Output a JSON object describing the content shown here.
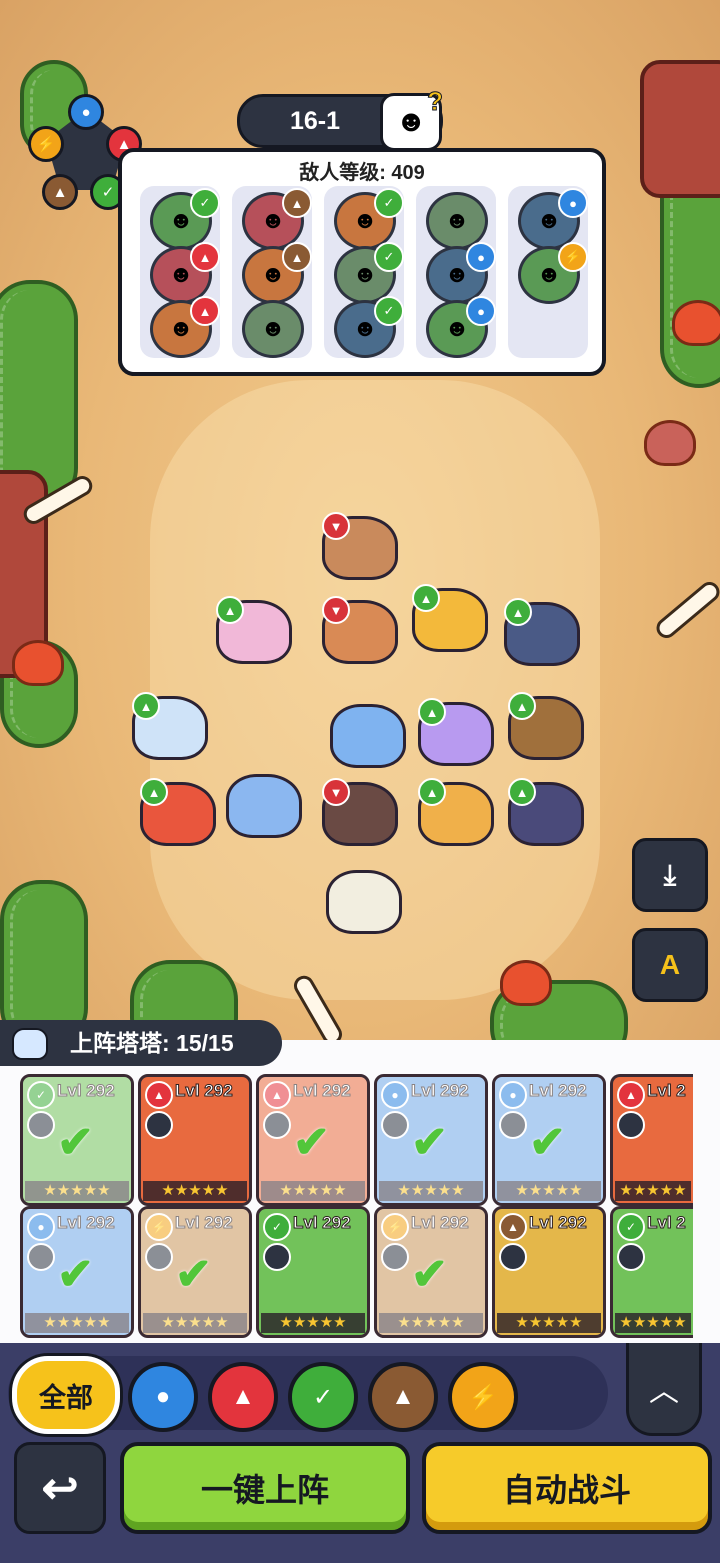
{
  "stage": {
    "label": "16-1"
  },
  "enemy_panel": {
    "title": "敌人等级: 409",
    "columns": [
      [
        {
          "element": "nature"
        },
        {
          "element": "fire"
        },
        {
          "element": "fire"
        }
      ],
      [
        {
          "element": "earth"
        },
        {
          "element": "earth"
        },
        {
          "element": ""
        }
      ],
      [
        {
          "element": "nature"
        },
        {
          "element": "nature"
        },
        {
          "element": "nature"
        }
      ],
      [
        {
          "element": ""
        },
        {
          "element": "water"
        },
        {
          "element": "water"
        }
      ],
      [
        {
          "element": "water"
        },
        {
          "element": "lightning"
        }
      ]
    ]
  },
  "roster": {
    "title": "上阵塔塔: 15/15"
  },
  "cards": [
    {
      "level": "Lvl 292",
      "element": "nature",
      "deployed": true
    },
    {
      "level": "Lvl 292",
      "element": "fire",
      "deployed": false
    },
    {
      "level": "Lvl 292",
      "element": "fire",
      "deployed": true
    },
    {
      "level": "Lvl 292",
      "element": "water",
      "deployed": true
    },
    {
      "level": "Lvl 292",
      "element": "water",
      "deployed": true
    },
    {
      "level": "Lvl 2",
      "element": "fire",
      "deployed": false
    },
    {
      "level": "Lvl 292",
      "element": "water",
      "deployed": true
    },
    {
      "level": "Lvl 292",
      "element": "lightning",
      "deployed": true
    },
    {
      "level": "Lvl 292",
      "element": "nature",
      "deployed": false
    },
    {
      "level": "Lvl 292",
      "element": "lightning",
      "deployed": true
    },
    {
      "level": "Lvl 292",
      "element": "earth",
      "deployed": false
    },
    {
      "level": "Lvl 2",
      "element": "nature",
      "deployed": false
    }
  ],
  "filters": {
    "all_label": "全部",
    "elements": [
      "water",
      "fire",
      "nature",
      "earth",
      "lightning"
    ]
  },
  "buttons": {
    "deploy_label": "一键上阵",
    "auto_battle_label": "自动战斗",
    "auto_settings_label": "A"
  },
  "colors": {
    "water": "#2f86e0",
    "fire": "#e3343d",
    "nature": "#3fae3b",
    "earth": "#8a5a33",
    "lightning": "#f2a418",
    "up": "#3fae3b",
    "down": "#d8333a"
  },
  "board_units": [
    {
      "thumb": "down",
      "color": "#c98a5c"
    },
    {
      "thumb": "up",
      "color": "#f1b8d8"
    },
    {
      "thumb": "down",
      "color": "#d98a55"
    },
    {
      "thumb": "up",
      "color": "#f3b93b"
    },
    {
      "thumb": "up",
      "color": "#4a5a86"
    },
    {
      "thumb": "up",
      "color": "#cfe3f8"
    },
    {
      "thumb": "",
      "color": "#7fb3f0"
    },
    {
      "thumb": "up",
      "color": "#b89af0"
    },
    {
      "thumb": "up",
      "color": "#a0703c"
    },
    {
      "thumb": "up",
      "color": "#e9563d"
    },
    {
      "thumb": "",
      "color": "#8bb7f0"
    },
    {
      "thumb": "down",
      "color": "#6a4a44"
    },
    {
      "thumb": "up",
      "color": "#f0b04a"
    },
    {
      "thumb": "up",
      "color": "#4a4a7a"
    },
    {
      "thumb": "",
      "color": "#f2eee0"
    }
  ]
}
